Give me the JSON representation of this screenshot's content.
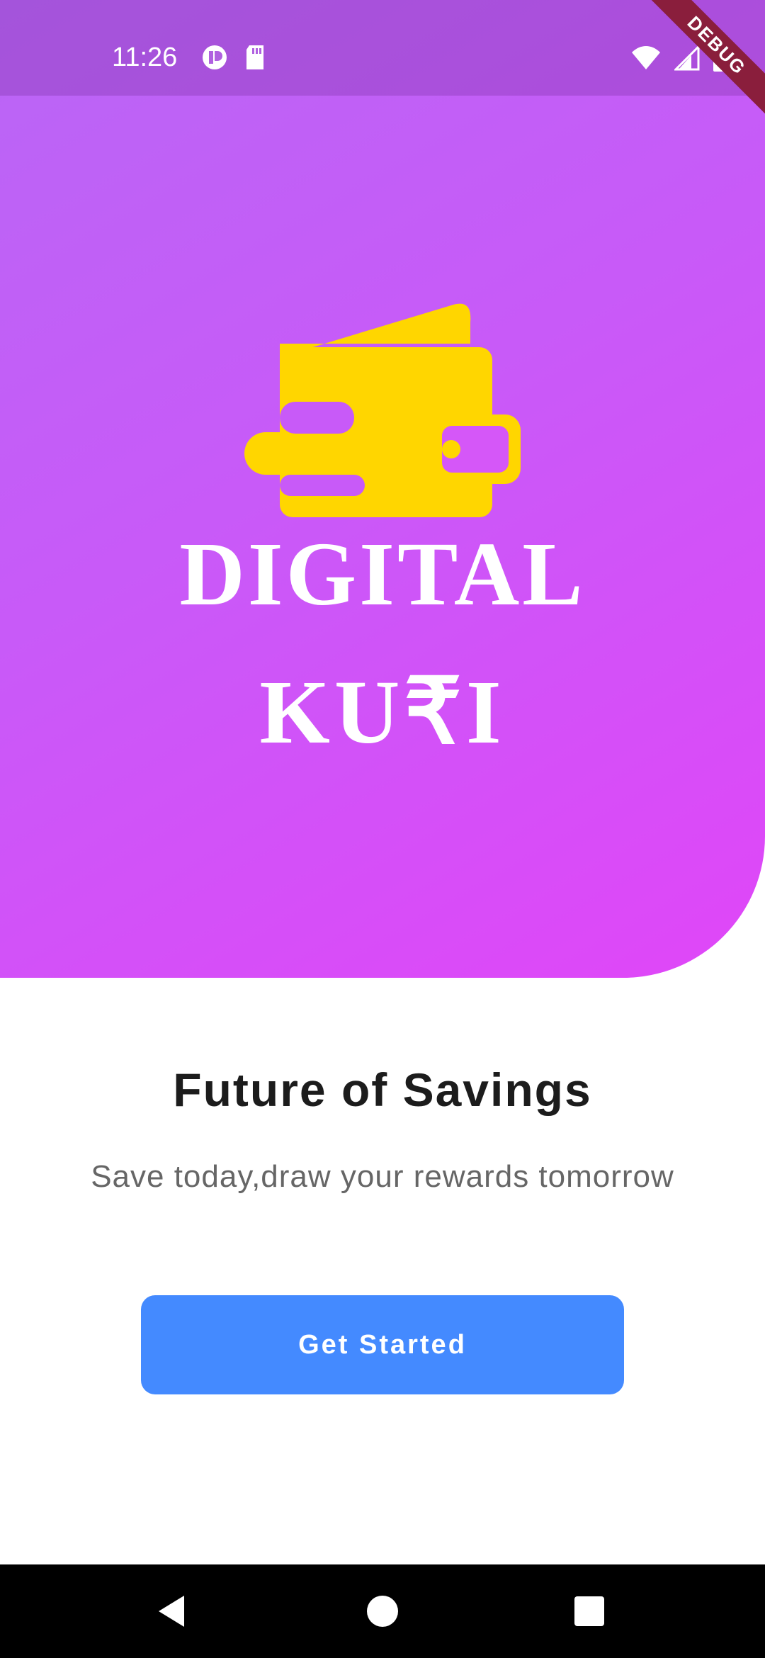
{
  "status_bar": {
    "time": "11:26",
    "left_icons": [
      "sync-icon",
      "sd-card-icon"
    ],
    "right_icons": [
      "wifi-icon",
      "cellular-signal-icon",
      "battery-icon"
    ]
  },
  "debug_banner": "DEBUG",
  "hero": {
    "logo_icon": "wallet-icon",
    "brand_line1": "DIGITAL",
    "brand_line2": "KU₹I",
    "gradient_start": "#b966f5",
    "gradient_end": "#e046f8",
    "logo_color": "#ffd600"
  },
  "content": {
    "headline": "Future of Savings",
    "subtitle": "Save today,draw your rewards tomorrow"
  },
  "cta": {
    "label": "Get Started",
    "color": "#448aff"
  },
  "nav_bar": {
    "buttons": [
      "back-icon",
      "home-icon",
      "recents-icon"
    ]
  }
}
